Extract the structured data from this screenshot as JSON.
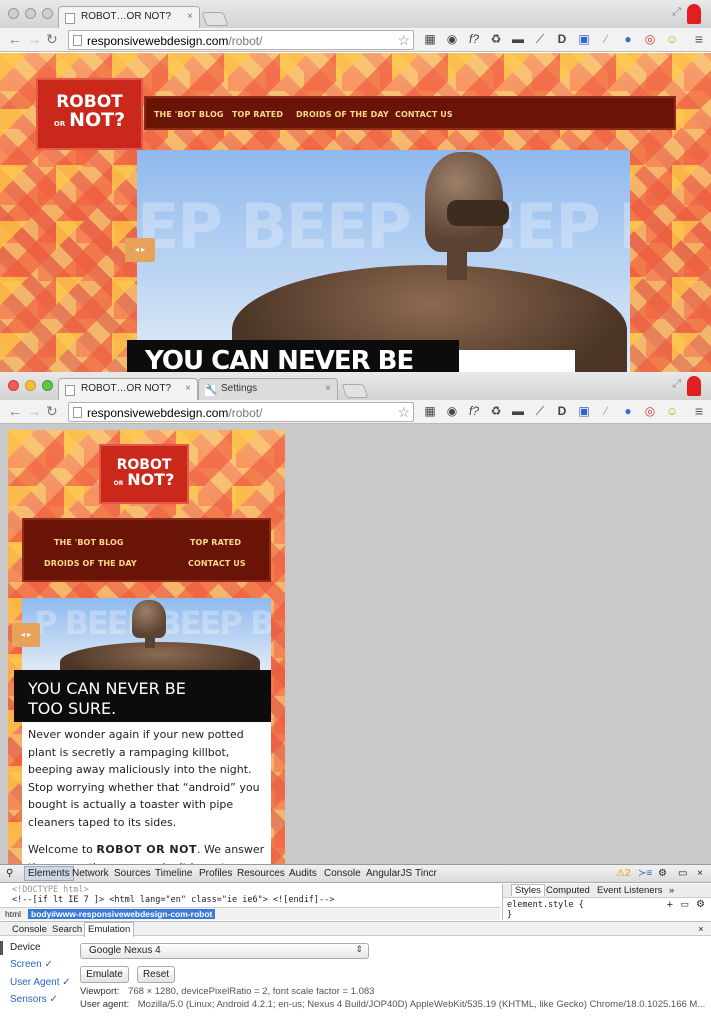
{
  "window1": {
    "tabs": [
      {
        "title": "ROBOT…OR NOT?",
        "close": "×"
      }
    ],
    "url_host": "responsivewebdesign.com",
    "url_path": "/robot/",
    "site": {
      "logo_line1": "ROBOT",
      "logo_line2": "OR",
      "logo_line3": "NOT?",
      "nav": [
        "THE 'BOT BLOG",
        "TOP RATED",
        "DROIDS OF THE DAY",
        "CONTACT US"
      ],
      "hero_text": "EP BEEP BEEP BE",
      "headline": "YOU CAN NEVER BE"
    }
  },
  "window2": {
    "tabs": [
      {
        "title": "ROBOT…OR NOT?",
        "close": "×"
      },
      {
        "title": "Settings",
        "close": "×"
      }
    ],
    "url_host": "responsivewebdesign.com",
    "url_path": "/robot/",
    "site": {
      "logo_line1": "ROBOT",
      "logo_line2": "OR",
      "logo_line3": "NOT?",
      "nav": [
        "THE 'BOT BLOG",
        "TOP RATED",
        "DROIDS OF THE DAY",
        "CONTACT US"
      ],
      "hero_text": "P BEEP BEEP BE",
      "headline_line1": "YOU CAN NEVER BE",
      "headline_line2": "TOO SURE.",
      "para1": "Never wonder again if your new potted plant is secretly a rampaging killbot, beeping away maliciously into the night. Stop worrying whether that “android” you bought is actually a toaster with pipe cleaners taped to its sides.",
      "para2_prefix": "Welcome to ",
      "para2_bold": "ROBOT OR NOT",
      "para2_suffix": ". We answer these questions so you don’t have to."
    }
  },
  "devtools": {
    "tabs": [
      "Elements",
      "Network",
      "Sources",
      "Timeline",
      "Profiles",
      "Resources",
      "Audits",
      "Console",
      "AngularJS",
      "Tincr"
    ],
    "warning_count": "2",
    "dom_line1": "<!DOCTYPE html>",
    "dom_line2": "<!--[if lt IE 7 ]> <html lang=\"en\" class=\"ie ie6\"> <![endif]-->",
    "crumbs": [
      "html",
      "body#www-responsivewebdesign-com-robot"
    ],
    "styles_tabs": [
      "Styles",
      "Computed",
      "Event Listeners",
      "»"
    ],
    "element_style": "element.style {",
    "element_style_close": "}",
    "drawer_tabs": [
      "Console",
      "Search",
      "Emulation"
    ],
    "emulation": {
      "side": [
        "Device",
        "Screen ✓",
        "User Agent ✓",
        "Sensors ✓"
      ],
      "device": "Google Nexus 4",
      "emulate_label": "Emulate",
      "reset_label": "Reset",
      "viewport_label": "Viewport:",
      "viewport_value": "768 × 1280, devicePixelRatio = 2, font scale factor = 1.083",
      "ua_label": "User agent:",
      "ua_value": "Mozilla/5.0 (Linux; Android 4.2.1; en-us; Nexus 4 Build/JOP40D) AppleWebKit/535.19 (KHTML, like Gecko) Chrome/18.0.1025.166 M..."
    }
  },
  "icons": [
    "back-icon",
    "forward-icon",
    "reload-icon",
    "bookmark-star-icon",
    "menu-icon",
    "search-icon",
    "settings-gear-icon",
    "warning-icon",
    "dock-icon",
    "close-icon"
  ]
}
